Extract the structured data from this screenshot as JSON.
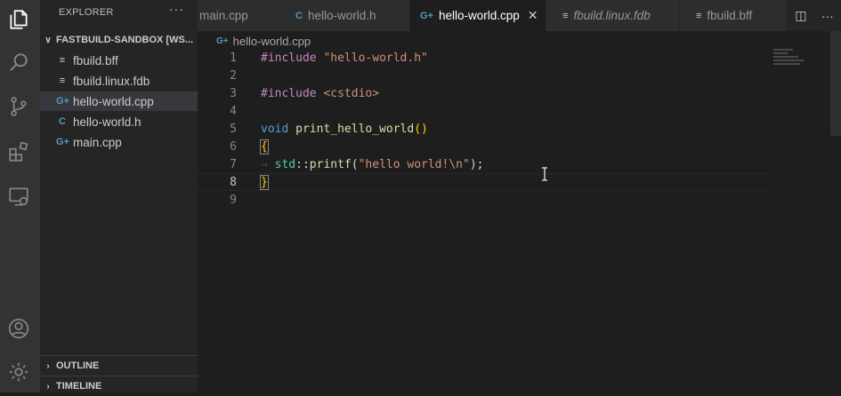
{
  "explorer": {
    "title": "EXPLORER",
    "more": "···",
    "folder": "FASTBUILD-SANDBOX [WS...",
    "files": [
      {
        "name": "fbuild.bff",
        "icon": "≡"
      },
      {
        "name": "fbuild.linux.fdb",
        "icon": "≡"
      },
      {
        "name": "hello-world.cpp",
        "icon": "G+"
      },
      {
        "name": "hello-world.h",
        "icon": "C"
      },
      {
        "name": "main.cpp",
        "icon": "G+"
      }
    ],
    "outline": "OUTLINE",
    "timeline": "TIMELINE"
  },
  "tabs": [
    {
      "label": "main.cpp",
      "icon": ""
    },
    {
      "label": "hello-world.h",
      "icon": "C"
    },
    {
      "label": "hello-world.cpp",
      "icon": "G+"
    },
    {
      "label": "fbuild.linux.fdb",
      "icon": "≡"
    },
    {
      "label": "fbuild.bff",
      "icon": "≡"
    }
  ],
  "tab_close": "✕",
  "tab_actions": {
    "split": "◫",
    "more": "···"
  },
  "breadcrumb": {
    "icon": "G+",
    "file": "hello-world.cpp"
  },
  "editor": {
    "line_numbers": [
      "1",
      "2",
      "3",
      "4",
      "5",
      "6",
      "7",
      "8",
      "9"
    ],
    "l1_directive": "#include",
    "l1_string": "\"hello-world.h\"",
    "l3_directive": "#include",
    "l3_header": "<cstdio>",
    "l5_type": "void",
    "l5_func": "print_hello_world",
    "l5_parens": "()",
    "l6_brace": "{",
    "l7_arrow": "→",
    "l7_ns": "std",
    "l7_sep": "::",
    "l7_func": "printf",
    "l7_open": "(",
    "l7_str": "\"hello world!\\n\"",
    "l7_close": ");",
    "l8_brace": "}"
  }
}
